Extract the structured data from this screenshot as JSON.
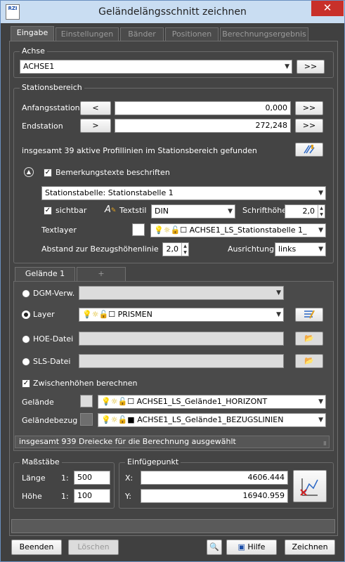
{
  "window": {
    "app_icon_text": "RZI",
    "title": "Geländelängsschnitt zeichnen",
    "close_glyph": "✕"
  },
  "tabs": [
    "Eingabe",
    "Einstellungen",
    "Bänder",
    "Positionen",
    "Berechnungsergebnis"
  ],
  "achse": {
    "label": "Achse",
    "value": "ACHSE1",
    "button": ">>"
  },
  "station": {
    "label": "Stationsbereich",
    "start_label": "Anfangsstation",
    "start_btn": "<",
    "start_value": "0,000",
    "start_btn2": ">>",
    "end_label": "Endstation",
    "end_btn": ">",
    "end_value": "272,248",
    "end_btn2": ">>",
    "info": "insgesamt 39 aktive Profillinien im Stationsbereich gefunden",
    "remarks_label": "Bemerkungstexte beschriften",
    "table_value": "Stationstabelle: Stationstabelle 1",
    "visible_label": "sichtbar",
    "textstyle_label": "Textstil",
    "textstyle_value": "DIN",
    "fontheight_label": "Schrifthöhe",
    "fontheight_value": "2,0",
    "textlayer_label": "Textlayer",
    "textlayer_value": "ACHSE1_LS_Stationstabelle 1_",
    "distance_label": "Abstand zur Bezugshöhenlinie",
    "distance_value": "2,0",
    "align_label": "Ausrichtung",
    "align_value": "links"
  },
  "gelaende": {
    "tab_label": "Gelände 1",
    "tab_add": "+",
    "dgm_label": "DGM-Verw.",
    "layer_label": "Layer",
    "layer_value": "PRISMEN",
    "hoe_label": "HOE-Datei",
    "sls_label": "SLS-Datei",
    "intermediate_label": "Zwischenhöhen berechnen",
    "terrain_label": "Gelände",
    "terrain_value": "ACHSE1_LS_Gelände1_HORIZONT",
    "ref_label": "Geländebezug",
    "ref_value": "ACHSE1_LS_Gelände1_BEZUGSLINIEN",
    "status": "insgesamt 939 Dreiecke für die Berechnung ausgewählt"
  },
  "scales": {
    "label": "Maßstäbe",
    "length_label": "Länge",
    "length_prefix": "1:",
    "length_value": "500",
    "height_label": "Höhe",
    "height_prefix": "1:",
    "height_value": "100"
  },
  "insert": {
    "label": "Einfügepunkt",
    "x_label": "X:",
    "x_value": "4606.444",
    "y_label": "Y:",
    "y_value": "16940.959"
  },
  "footer": {
    "quit": "Beenden",
    "delete": "Löschen",
    "help": "Hilfe",
    "draw": "Zeichnen"
  },
  "colors": {
    "titlebar": "#c9ddf2",
    "close": "#c8302a",
    "panel": "#444444"
  }
}
